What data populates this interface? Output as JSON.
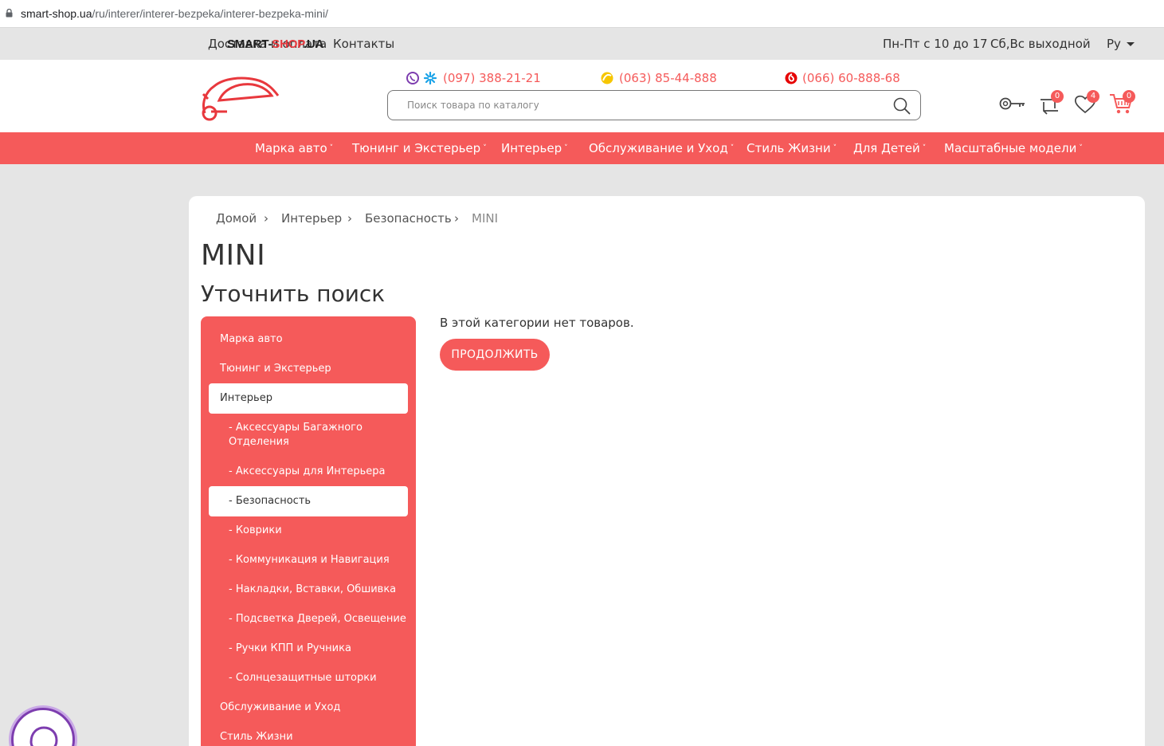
{
  "browser": {
    "url_domain": "smart-shop.ua",
    "url_path": "/ru/interer/interer-bezpeka/interer-bezpeka-mini/"
  },
  "topbar": {
    "links": [
      "Доставка и оплата",
      "Контакты"
    ],
    "hours_weekdays": "Пн-Пт с 10 до 17",
    "hours_weekend": "Сб,Вс выходной",
    "language": "Ру"
  },
  "header": {
    "logo_part1": "SMART-",
    "logo_part2": "SHOP",
    "logo_part3": ".UA",
    "phones": [
      "(097) 388-21-21",
      "(063) 85-44-888",
      "(066) 60-888-68"
    ],
    "search_placeholder": "Поиск товара по каталогу",
    "compare_count": "0",
    "wishlist_count": "4",
    "cart_count": "0"
  },
  "nav": {
    "items": [
      "Марка авто",
      "Тюнинг и Экстерьер",
      "Интерьер",
      "Обслуживание и Уход",
      "Стиль Жизни",
      "Для Детей",
      "Масштабные модели"
    ],
    "chevron": "˅"
  },
  "breadcrumb": {
    "items": [
      "Домой",
      "Интерьер",
      "Безопасность",
      "MINI"
    ],
    "separator": "›"
  },
  "page": {
    "title": "MINI",
    "refine_title": "Уточнить поиск",
    "empty_text": "В этой категории нет товаров.",
    "continue_button": "ПРОДОЛЖИТЬ"
  },
  "sidebar": {
    "items": [
      {
        "label": "Марка авто"
      },
      {
        "label": "Тюнинг и Экстерьер"
      },
      {
        "label": "Интерьер"
      },
      {
        "label": "- Аксессуары Багажного Отделения"
      },
      {
        "label": "- Аксессуары для Интерьера"
      },
      {
        "label": "- Безопасность"
      },
      {
        "label": "- Коврики"
      },
      {
        "label": "- Коммуникация и Навигация"
      },
      {
        "label": "- Накладки, Вставки, Обшивка"
      },
      {
        "label": "- Подсветка Дверей, Освещение"
      },
      {
        "label": "- Ручки КПП и Ручника"
      },
      {
        "label": "- Солнцезащитные шторки"
      },
      {
        "label": "Обслуживание и Уход"
      },
      {
        "label": "Стиль Жизни"
      }
    ]
  },
  "colors": {
    "accent": "#f55a5a",
    "viber": "#7d3daf",
    "page_bg": "#e5e5e5"
  }
}
